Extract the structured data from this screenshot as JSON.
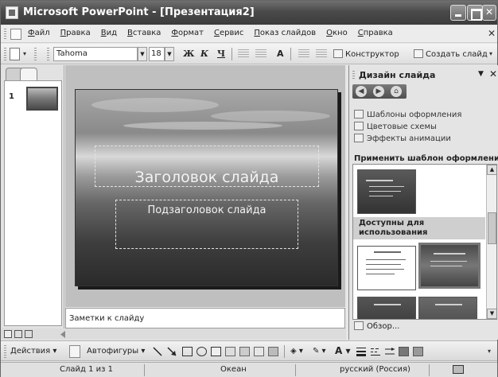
{
  "window": {
    "title": "Microsoft PowerPoint - [Презентация2]"
  },
  "menubar": {
    "items": [
      "Файл",
      "Правка",
      "Вид",
      "Вставка",
      "Формат",
      "Сервис",
      "Показ слайдов",
      "Окно",
      "Справка"
    ]
  },
  "toolbar": {
    "font": "Tahoma",
    "size": "18",
    "bold": "Ж",
    "italic": "К",
    "underline": "Ч",
    "font_color": "A",
    "designer_label": "Конструктор",
    "new_slide_label": "Создать слайд"
  },
  "thumbnails": {
    "slide_number": "1"
  },
  "slide": {
    "title_placeholder": "Заголовок слайда",
    "subtitle_placeholder": "Подзаголовок слайда"
  },
  "notes": {
    "placeholder": "Заметки к слайду"
  },
  "taskpane": {
    "title": "Дизайн слайда",
    "links": [
      "Шаблоны оформления",
      "Цветовые схемы",
      "Эффекты анимации"
    ],
    "apply_label": "Применить шаблон оформления:",
    "available_label": "Доступны для использования",
    "browse_label": "Обзор..."
  },
  "drawbar": {
    "actions_label": "Действия",
    "autoshapes_label": "Автофигуры"
  },
  "statusbar": {
    "slide_info": "Слайд 1 из 1",
    "design_name": "Океан",
    "language": "русский (Россия)"
  }
}
